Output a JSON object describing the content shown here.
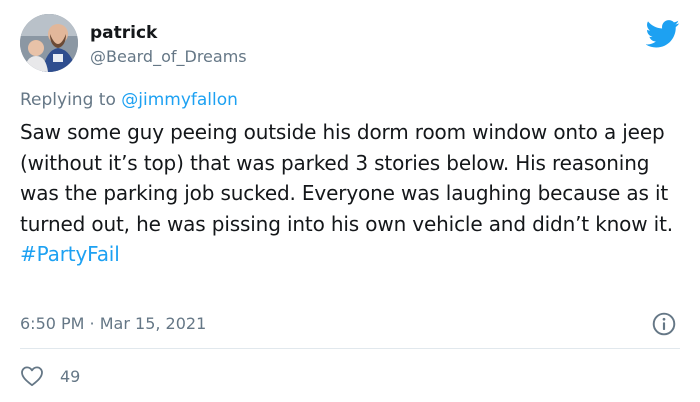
{
  "author": {
    "display_name": "patrick",
    "handle": "@Beard_of_Dreams"
  },
  "reply_to": {
    "prefix": "Replying to ",
    "handle": "@jimmyfallon"
  },
  "tweet": {
    "text": "Saw some guy peeing outside his dorm room window onto a jeep (without it’s top) that was parked 3 stories below. His reasoning was the parking job sucked.  Everyone was laughing because as it turned out, he was pissing into his own vehicle and didn’t know it. ",
    "hashtag": "#PartyFail"
  },
  "meta": {
    "time": "6:50 PM",
    "separator": " · ",
    "date": "Mar 15, 2021"
  },
  "engagement": {
    "likes": "49"
  },
  "icons": {
    "brand": "twitter-bird-icon",
    "info": "info-circle-icon",
    "like": "heart-outline-icon"
  },
  "colors": {
    "accent": "#1da1f2",
    "muted": "#657786",
    "text": "#14171a",
    "divider": "#e1e8ed"
  }
}
